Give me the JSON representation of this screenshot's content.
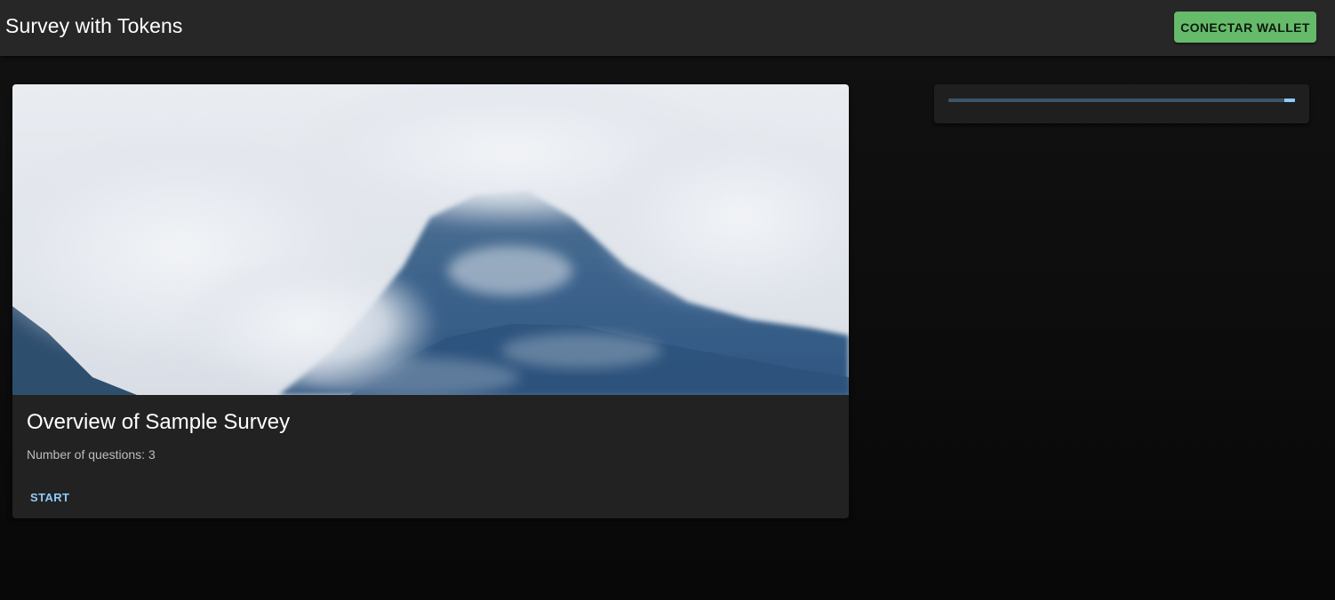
{
  "header": {
    "title": "Survey with Tokens",
    "connect_wallet_label": "CONECTAR WALLET",
    "connect_wallet_color": "#66bb6a"
  },
  "survey_card": {
    "image_subject": "misty mountain peak covered in clouds",
    "title": "Overview of Sample Survey",
    "questions_text": "Number of questions: 3",
    "start_label": "START",
    "accent_color": "#90caf9"
  },
  "progress": {
    "indicator_fraction": 0.03,
    "track_color": "#3c5468",
    "fill_color": "#90caf9"
  }
}
